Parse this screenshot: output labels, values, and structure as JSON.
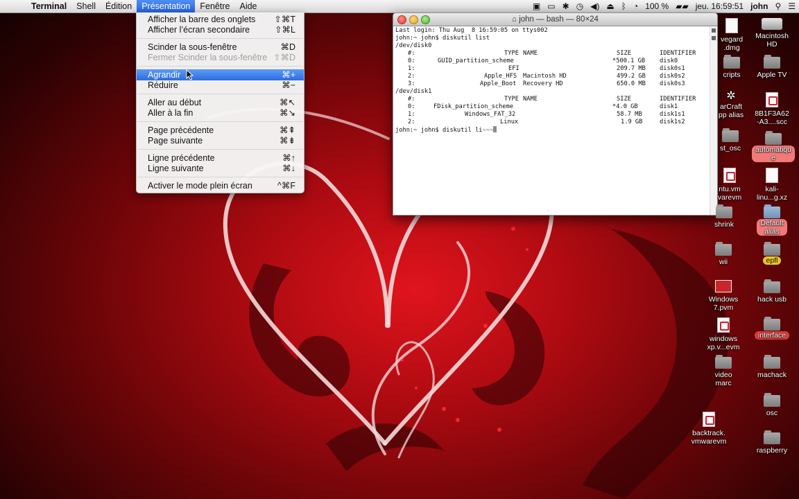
{
  "menubar": {
    "app_name": "Terminal",
    "items": [
      "Shell",
      "Édition",
      "Présentation",
      "Fenêtre",
      "Aide"
    ],
    "active_item": "Présentation",
    "status": {
      "battery": "100 %",
      "clock": "jeu. 16:59:51",
      "user": "john"
    }
  },
  "dropdown": {
    "items": [
      {
        "label": "Afficher la barre des onglets",
        "shortcut": "⇧⌘T",
        "enabled": true
      },
      {
        "label": "Afficher l’écran secondaire",
        "shortcut": "⇧⌘L",
        "enabled": true
      },
      {
        "label": "Scinder la sous-fenêtre",
        "shortcut": "⌘D",
        "enabled": true
      },
      {
        "label": "Fermer Scinder la sous-fenêtre",
        "shortcut": "⇧⌘D",
        "enabled": false
      },
      {
        "label": "Agrandir",
        "shortcut": "⌘+",
        "enabled": true,
        "highlighted": true
      },
      {
        "label": "Réduire",
        "shortcut": "⌘−",
        "enabled": true
      },
      {
        "label": "Aller au début",
        "shortcut": "⌘↖",
        "enabled": true
      },
      {
        "label": "Aller à la fin",
        "shortcut": "⌘↘",
        "enabled": true
      },
      {
        "label": "Page précédente",
        "shortcut": "⌘⇞",
        "enabled": true
      },
      {
        "label": "Page suivante",
        "shortcut": "⌘⇟",
        "enabled": true
      },
      {
        "label": "Ligne précédente",
        "shortcut": "⌘↑",
        "enabled": true
      },
      {
        "label": "Ligne suivante",
        "shortcut": "⌘↓",
        "enabled": true
      },
      {
        "label": "Activer le mode plein écran",
        "shortcut": "^⌘F",
        "enabled": true
      }
    ]
  },
  "terminal": {
    "title": "john — bash — 80×24",
    "lines": {
      "login": "Last login: Thu Aug  8 16:59:05 on ttys002",
      "cmd1": "john:~ john$ diskutil list",
      "disk0": "/dev/disk0",
      "disk1": "/dev/disk1",
      "cmd2": "john:~ john$ diskutil li"
    },
    "headers": {
      "num": "#:",
      "type": "TYPE",
      "name": "NAME",
      "size": "SIZE",
      "identifier": "IDENTIFIER"
    },
    "disk0_rows": [
      {
        "num": "0:",
        "type": "GUID_partition_scheme",
        "name": "",
        "size": "*500.1 GB",
        "id": "disk0"
      },
      {
        "num": "1:",
        "type": "EFI",
        "name": "",
        "size": "209.7 MB",
        "id": "disk0s1"
      },
      {
        "num": "2:",
        "type": "Apple_HFS",
        "name": "Macintosh HD",
        "size": "499.2 GB",
        "id": "disk0s2"
      },
      {
        "num": "3:",
        "type": "Apple_Boot",
        "name": "Recovery HD",
        "size": "650.0 MB",
        "id": "disk0s3"
      }
    ],
    "disk1_rows": [
      {
        "num": "0:",
        "type": "FDisk_partition_scheme",
        "name": "",
        "size": "*4.0 GB",
        "id": "disk1"
      },
      {
        "num": "1:",
        "type": "Windows_FAT_32",
        "name": "",
        "size": "58.7 MB",
        "id": "disk1s1"
      },
      {
        "num": "2:",
        "type": "Linux",
        "name": "",
        "size": "1.9 GB",
        "id": "disk1s2"
      }
    ]
  },
  "desktop_icons": [
    {
      "label": "vegard\n.dmg",
      "icon": "doc"
    },
    {
      "label": "Macintosh\nHD",
      "icon": "disk"
    },
    {
      "label": "cripts",
      "icon": "folder"
    },
    {
      "label": "Apple TV",
      "icon": "folder"
    },
    {
      "label": "arCraft\npp alias",
      "icon": "gear"
    },
    {
      "label": "8B1F3A62\n-A3....scc",
      "icon": "doc"
    },
    {
      "label": "st_osc",
      "icon": "folder"
    },
    {
      "label": "automatiqu\ne",
      "icon": "folder"
    },
    {
      "label": "ntu.vm\nvarevm",
      "icon": "doc-vm"
    },
    {
      "label": "kali-\nlinu...g.xz",
      "icon": "doc"
    },
    {
      "label": "shrink",
      "icon": "folder"
    },
    {
      "label": "Default\nalias",
      "icon": "folder"
    },
    {
      "label": "wii",
      "icon": "folder"
    },
    {
      "label": "epfl",
      "icon": "folder"
    },
    {
      "label": "Windows\n7.pvm",
      "icon": "pvm"
    },
    {
      "label": "hack usb",
      "icon": "folder"
    },
    {
      "label": "windows\nxp.v...evm",
      "icon": "doc-vm"
    },
    {
      "label": "interface",
      "icon": "folder"
    },
    {
      "label": "video\nmarc",
      "icon": "folder"
    },
    {
      "label": "machack",
      "icon": "folder"
    },
    {
      "label": "osc",
      "icon": "folder"
    },
    {
      "label": "backtrack.\nvmwarevm",
      "icon": "doc-vm"
    },
    {
      "label": "raspberry",
      "icon": "folder"
    }
  ]
}
